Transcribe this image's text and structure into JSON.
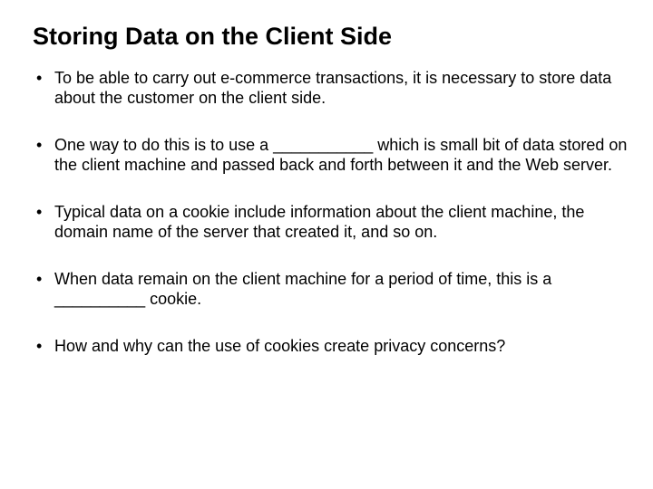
{
  "slide": {
    "title": "Storing Data on the Client Side",
    "bullets": [
      "To be able to carry out e-commerce transactions, it is necessary to store data about the customer on the client side.",
      "One way to do this is to use a ___________ which is small bit of data stored on the client machine and passed back and forth between it and the Web server.",
      "Typical data on a cookie include information about the client machine, the domain name of the server that created it, and so on.",
      "When data remain on the client machine for a period of time, this is a __________ cookie.",
      "How and why can the use of cookies create privacy concerns?"
    ]
  }
}
